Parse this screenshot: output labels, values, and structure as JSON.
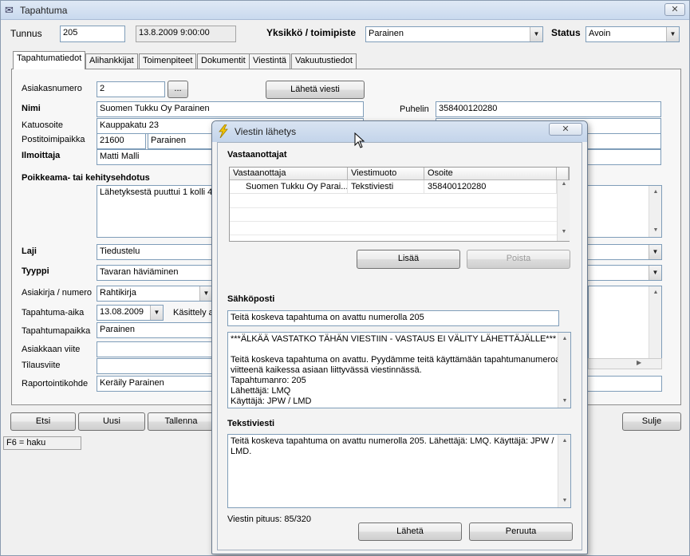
{
  "window": {
    "title": "Tapahtuma",
    "close_glyph": "✕"
  },
  "header": {
    "tunnus_label": "Tunnus",
    "tunnus_value": "205",
    "datetime_value": "13.8.2009 9:00:00",
    "yksikko_label": "Yksikkö / toimipiste",
    "yksikko_value": "Parainen",
    "status_label": "Status",
    "status_value": "Avoin"
  },
  "tabs": [
    {
      "label": "Tapahtumatiedot"
    },
    {
      "label": "Alihankkijat"
    },
    {
      "label": "Toimenpiteet"
    },
    {
      "label": "Dokumentit"
    },
    {
      "label": "Viestintä"
    },
    {
      "label": "Vakuutustiedot"
    }
  ],
  "form": {
    "asiakasnumero_label": "Asiakasnumero",
    "asiakasnumero_value": "2",
    "browse_label": "...",
    "send_message_label": "Lähetä viesti",
    "nimi_label": "Nimi",
    "nimi_value": "Suomen Tukku Oy Parainen",
    "puhelin_label": "Puhelin",
    "puhelin_value": "358400120280",
    "katuosoite_label": "Katuosoite",
    "katuosoite_value": "Kauppakatu 23",
    "postitoimipaikka_label": "Postitoimipaikka",
    "postinumero_value": "21600",
    "postitoimipaikka_value": "Parainen",
    "ilmoittaja_label": "Ilmoittaja",
    "ilmoittaja_value": "Matti Malli",
    "poikkeama_label": "Poikkeama- tai kehitysehdotus",
    "poikkeama_value": "Lähetyksestä puuttui 1 kolli 4",
    "laji_label": "Laji",
    "laji_value": "Tiedustelu",
    "tyyppi_label": "Tyyppi",
    "tyyppi_value": "Tavaran häviäminen",
    "asiakirja_label": "Asiakirja / numero",
    "asiakirja_value": "Rahtikirja",
    "tapahtuma_aika_label": "Tapahtuma-aika",
    "tapahtuma_aika_value": "13.08.2009",
    "kasittely_label": "Käsittely a",
    "tapahtumapaikka_label": "Tapahtumapaikka",
    "tapahtumapaikka_value": "Parainen",
    "asiakkaan_viite_label": "Asiakkaan viite",
    "tilausviite_label": "Tilausviite",
    "raportointikohde_label": "Raportointikohde",
    "raportointikohde_value": "Keräily Parainen"
  },
  "bottom_buttons": {
    "etsi": "Etsi",
    "uusi": "Uusi",
    "tallenna": "Tallenna",
    "sulje": "Sulje"
  },
  "statusbar": {
    "hint": "F6 = haku"
  },
  "dialog": {
    "title": "Viestin lähetys",
    "close_glyph": "✕",
    "recipients_heading": "Vastaanottajat",
    "columns": [
      "Vastaanottaja",
      "Viestimuoto",
      "Osoite"
    ],
    "rows": [
      {
        "recipient": "Suomen Tukku Oy Parai...",
        "method": "Tekstiviesti",
        "address": "358400120280"
      }
    ],
    "add_label": "Lisää",
    "remove_label": "Poista",
    "email_heading": "Sähköposti",
    "email_subject": "Teitä koskeva tapahtuma on avattu numerolla 205",
    "email_body_lines": [
      "***ÄLKÄÄ VASTATKO TÄHÄN VIESTIIN - VASTAUS EI VÄLITY LÄHETTÄJÄLLE***",
      "",
      "Teitä koskeva tapahtuma on avattu. Pyydämme teitä käyttämään tapahtumanumeroa",
      "viitteenä kaikessa asiaan liittyvässä viestinnässä.",
      "Tapahtumanro: 205",
      "Lähettäjä: LMQ",
      "Käyttäjä: JPW / LMD"
    ],
    "sms_heading": "Tekstiviesti",
    "sms_body_lines": [
      "Teitä koskeva tapahtuma on avattu numerolla 205. Lähettäjä: LMQ. Käyttäjä: JPW /",
      "LMD."
    ],
    "length_label": "Viestin pituus: 85/320",
    "send_label": "Lähetä",
    "cancel_label": "Peruuta"
  },
  "colors": {
    "accent": "#c3d4ea",
    "lightning_icon": "#f2c400"
  }
}
